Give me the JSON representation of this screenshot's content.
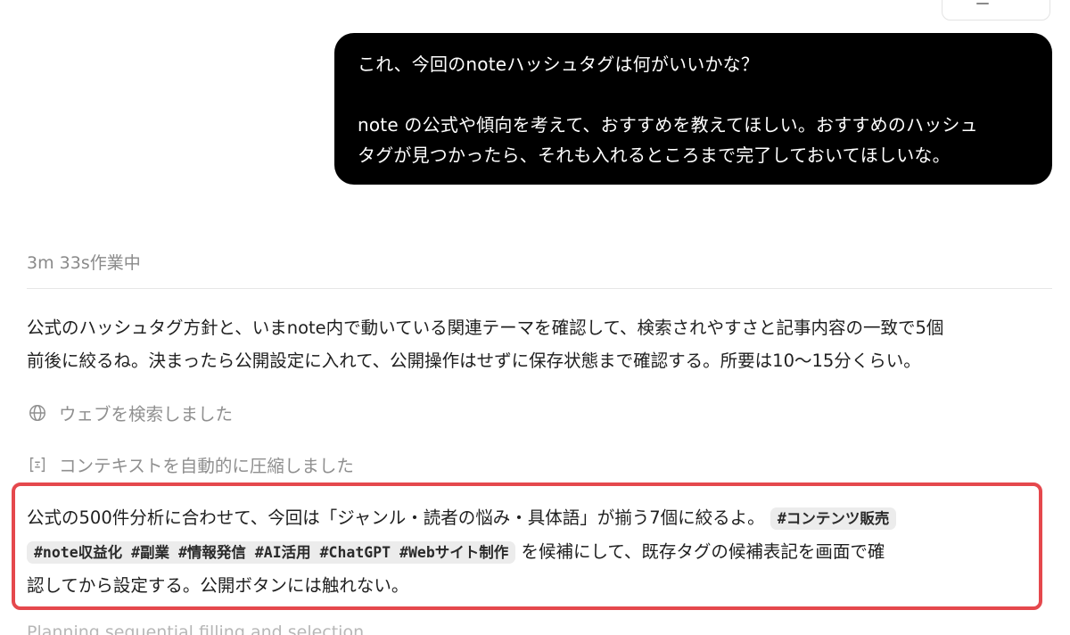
{
  "user_message": {
    "line1": "これ、今回のnoteハッシュタグは何がいいかな？",
    "line2": "note の公式や傾向を考えて、おすすめを教えてほしい。おすすめのハッシュ",
    "line3": "タグが見つかったら、それも入れるところまで完了しておいてほしいな。"
  },
  "status": {
    "elapsed": "3m 33s作業中"
  },
  "assistant": {
    "intro_line1": "公式のハッシュタグ方針と、いまnote内で動いている関連テーマを確認して、検索されやすさと記事内容の一致で5個",
    "intro_line2": "前後に絞るね。決まったら公開設定に入れて、公開操作はせずに保存状態まで確認する。所要は10〜15分くらい。",
    "activities": [
      {
        "icon": "globe-icon",
        "label": "ウェブを検索しました"
      },
      {
        "icon": "compress-context-icon",
        "label": "コンテキストを自動的に圧縮しました"
      }
    ],
    "summary_line1": "公式の500件分析に合わせて、今回は「ジャンル・読者の悩み・具体語」が揃う7個に絞るよ。",
    "summary_line2_suffix": " を候補にして、既存タグの候補表記を画面で確",
    "summary_line3": "認してから設定する。公開ボタンには触れない。",
    "tags": [
      "#コンテンツ販売",
      "#note収益化",
      "#副業",
      "#情報発信",
      "#AI活用",
      "#ChatGPT",
      "#Webサイト制作"
    ],
    "planning": "Planning sequential filling and selection"
  },
  "colors": {
    "user_bubble_bg": "#000000",
    "highlight_border": "#e5484d",
    "muted_text": "#8f8f8f",
    "tag_bg": "#ececec"
  }
}
